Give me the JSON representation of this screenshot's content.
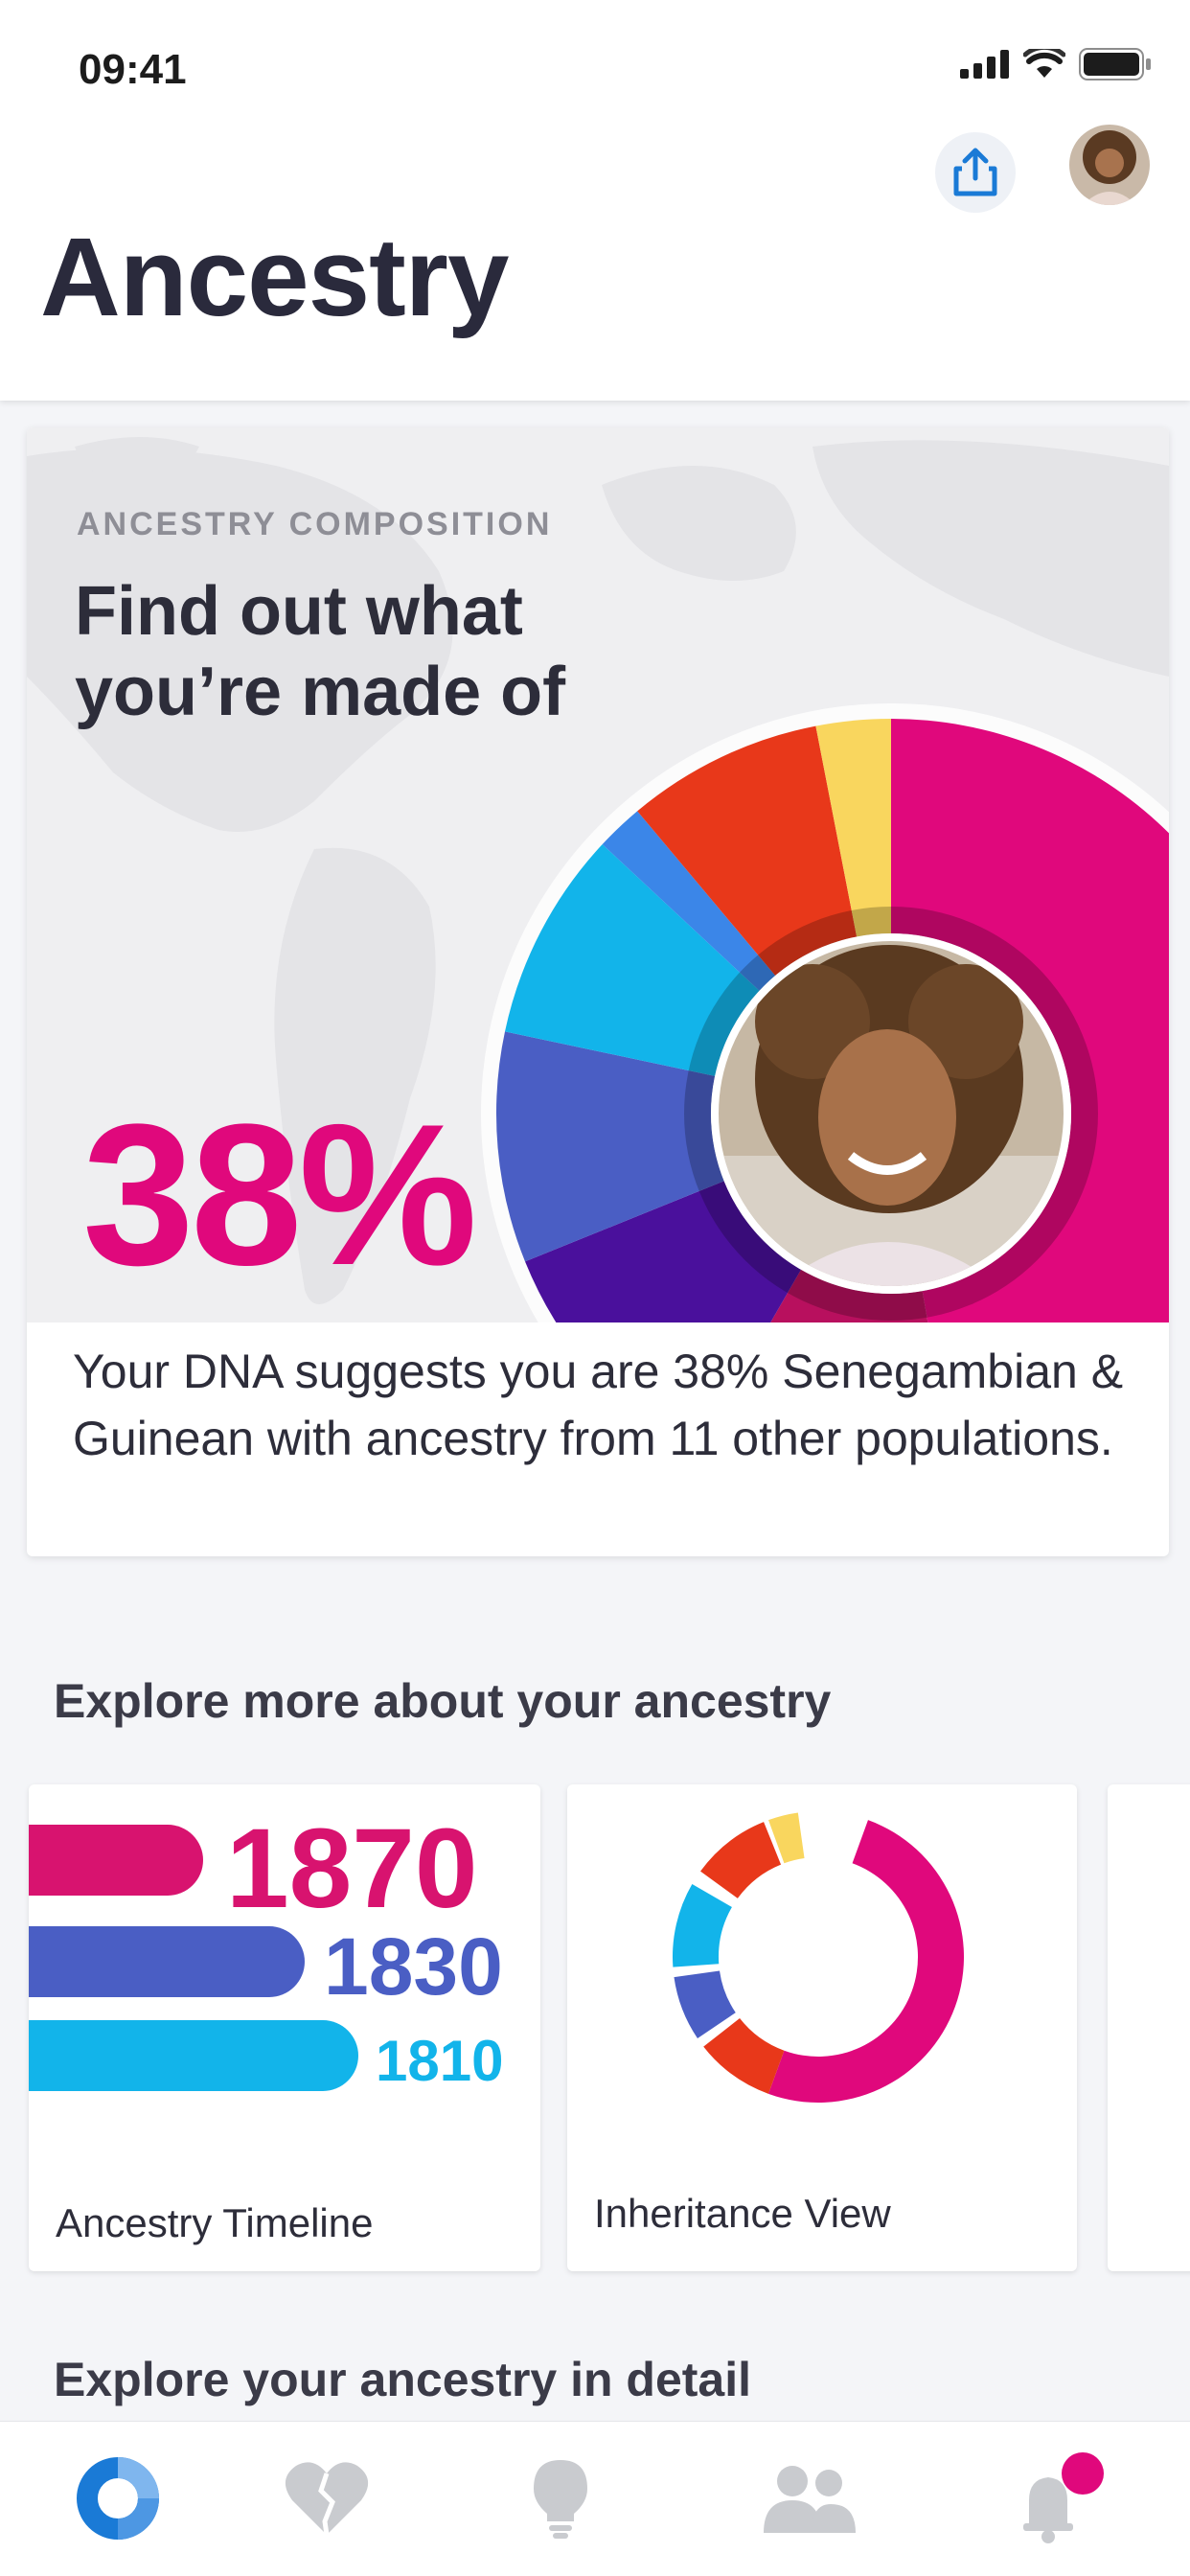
{
  "status": {
    "time": "09:41"
  },
  "header": {
    "title": "Ancestry"
  },
  "hero": {
    "eyebrow": "ANCESTRY COMPOSITION",
    "title": "Find out what you’re made of",
    "percent": "38%",
    "description": "Your DNA suggests you are 38% Senegambian & Guinean with ancestry from 11 other populations."
  },
  "explore": {
    "title": "Explore more about your ancestry",
    "cards": [
      {
        "label": "Ancestry Timeline",
        "years": [
          "1870",
          "1830",
          "1810"
        ]
      },
      {
        "label": "Inheritance View"
      }
    ]
  },
  "detail": {
    "title": "Explore your ancestry in detail"
  },
  "colors": {
    "magenta": "#e0087c",
    "royal_blue": "#4a5ec4",
    "sky_blue": "#12b4ea",
    "red_orange": "#e8381a",
    "yellow": "#f9d65e",
    "violet": "#4a109c",
    "blue": "#3b86e8"
  },
  "tabbar": {
    "items": [
      "ancestry-icon",
      "health-icon",
      "traits-icon",
      "relatives-icon",
      "notifications-icon"
    ]
  }
}
